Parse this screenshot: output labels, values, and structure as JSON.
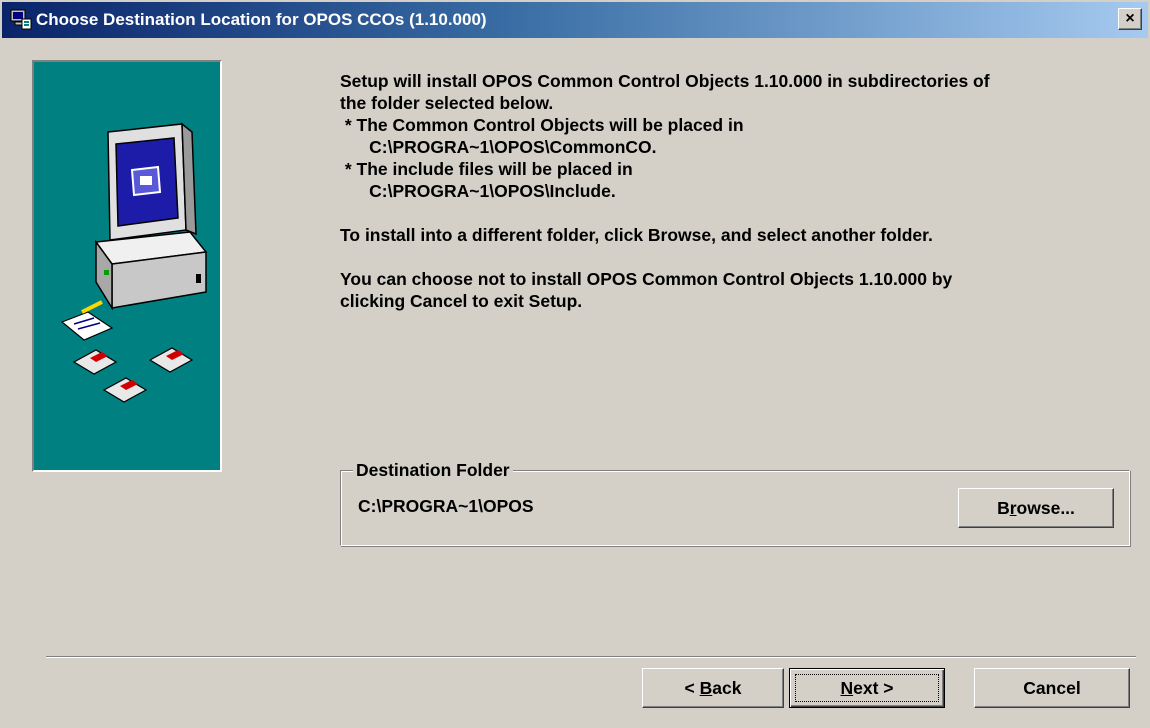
{
  "window": {
    "title": "Choose Destination Location for OPOS CCOs (1.10.000)",
    "close_label": "×"
  },
  "info": {
    "line1": "Setup will install OPOS Common Control Objects 1.10.000 in subdirectories of",
    "line2": "the folder selected below.",
    "line3": " * The Common Control Objects will be placed in",
    "line4": "      C:\\PROGRA~1\\OPOS\\CommonCO.",
    "line5": " * The include files will be placed in",
    "line6": "      C:\\PROGRA~1\\OPOS\\Include.",
    "line7": "To install into a different folder, click Browse, and select another folder.",
    "line8": "You can choose not to install OPOS Common Control Objects 1.10.000 by",
    "line9": "clicking Cancel to exit Setup."
  },
  "destination": {
    "legend": "Destination Folder",
    "path": "C:\\PROGRA~1\\OPOS",
    "browse_pre": "B",
    "browse_ul": "r",
    "browse_post": "owse..."
  },
  "buttons": {
    "back_pre": "< ",
    "back_ul": "B",
    "back_post": "ack",
    "next_ul": "N",
    "next_post": "ext >",
    "cancel": "Cancel"
  },
  "colors": {
    "panel": "#008080",
    "titlebar": "#0a246a",
    "dialog": "#d4d0c8"
  }
}
